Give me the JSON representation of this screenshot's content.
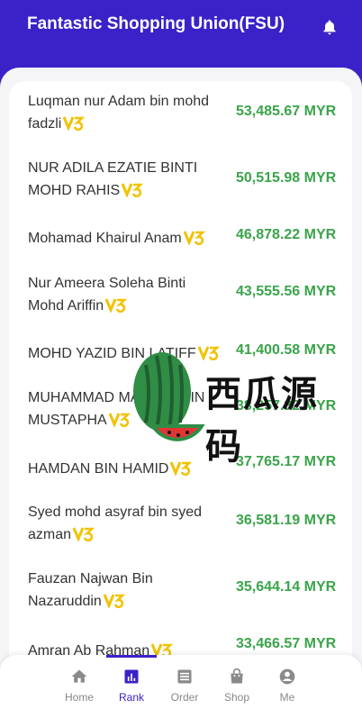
{
  "header": {
    "title": "Fantastic Shopping Union(FSU)",
    "notification_icon": "bell-icon"
  },
  "colors": {
    "primary": "#3a22c8",
    "amount": "#3aa44a",
    "badge": "#f2c200"
  },
  "ranking": [
    {
      "name": "Luqman nur Adam bin mohd fadzli",
      "amount": "53,485.67 MYR",
      "level": "V3"
    },
    {
      "name": "NUR ADILA EZATIE BINTI MOHD RAHIS",
      "amount": "50,515.98 MYR",
      "level": "V3"
    },
    {
      "name": "Mohamad Khairul Anam",
      "amount": "46,878.22 MYR",
      "level": "V3"
    },
    {
      "name": "Nur Ameera Soleha Binti Mohd Ariffin",
      "amount": "43,555.56 MYR",
      "level": "V3"
    },
    {
      "name": "MOHD YAZID BIN LATIFF",
      "amount": "41,400.58 MYR",
      "level": "V3"
    },
    {
      "name": "MUHAMMAD MAZLAN BIN MUSTAPHA",
      "amount": "38,257.32 MYR",
      "level": "V3"
    },
    {
      "name": "HAMDAN BIN HAMID",
      "amount": "37,765.17 MYR",
      "level": "V3"
    },
    {
      "name": "Syed mohd asyraf bin syed azman",
      "amount": "36,581.19 MYR",
      "level": "V3"
    },
    {
      "name": "Fauzan Najwan Bin Nazaruddin",
      "amount": "35,644.14 MYR",
      "level": "V3"
    },
    {
      "name": "Amran Ab Rahman",
      "amount": "33,466.57 MYR",
      "level": "V3"
    }
  ],
  "watermark": {
    "text": "西瓜源码"
  },
  "tabs": [
    {
      "label": "Home",
      "icon": "home-icon"
    },
    {
      "label": "Rank",
      "icon": "rank-icon",
      "active": true
    },
    {
      "label": "Order",
      "icon": "order-icon"
    },
    {
      "label": "Shop",
      "icon": "shop-icon"
    },
    {
      "label": "Me",
      "icon": "me-icon"
    }
  ]
}
